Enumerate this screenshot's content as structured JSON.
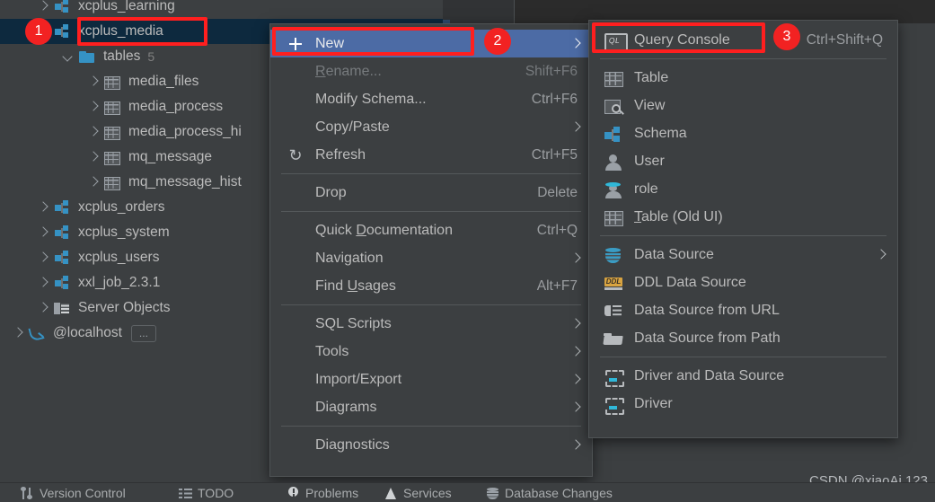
{
  "app": {
    "background": "#3c3f41",
    "accent_blue": "#4c6ba5",
    "annotation_red": "#f22222",
    "icon_blue": "#3592c4"
  },
  "sidebar": {
    "items": [
      {
        "label": "xcplus_learning",
        "icon": "schema-icon",
        "indent": 1,
        "arrow": "right",
        "selected": false
      },
      {
        "label": "xcplus_media",
        "icon": "schema-icon",
        "indent": 1,
        "arrow": "none",
        "selected": true
      },
      {
        "label": "tables",
        "icon": "folder-icon",
        "indent": 2,
        "arrow": "down",
        "selected": false,
        "count": "5"
      },
      {
        "label": "media_files",
        "icon": "table-icon",
        "indent": 3,
        "arrow": "right",
        "selected": false
      },
      {
        "label": "media_process",
        "icon": "table-icon",
        "indent": 3,
        "arrow": "right",
        "selected": false
      },
      {
        "label": "media_process_hi",
        "icon": "table-icon",
        "indent": 3,
        "arrow": "right",
        "selected": false
      },
      {
        "label": "mq_message",
        "icon": "table-icon",
        "indent": 3,
        "arrow": "right",
        "selected": false
      },
      {
        "label": "mq_message_hist",
        "icon": "table-icon",
        "indent": 3,
        "arrow": "right",
        "selected": false
      },
      {
        "label": "xcplus_orders",
        "icon": "schema-icon",
        "indent": 1,
        "arrow": "right",
        "selected": false
      },
      {
        "label": "xcplus_system",
        "icon": "schema-icon",
        "indent": 1,
        "arrow": "right",
        "selected": false
      },
      {
        "label": "xcplus_users",
        "icon": "schema-icon",
        "indent": 1,
        "arrow": "right",
        "selected": false
      },
      {
        "label": "xxl_job_2.3.1",
        "icon": "schema-icon",
        "indent": 1,
        "arrow": "right",
        "selected": false
      },
      {
        "label": "Server Objects",
        "icon": "server-objects-icon",
        "indent": 1,
        "arrow": "right",
        "selected": false
      },
      {
        "label": "@localhost",
        "icon": "mysql-icon",
        "indent": 0,
        "arrow": "right",
        "selected": false,
        "chip": "..."
      }
    ]
  },
  "context_menu": {
    "items": [
      {
        "label": "New",
        "shortcut": "",
        "icon": "plus-icon",
        "submenu": true,
        "highlight": true,
        "disabled": false
      },
      {
        "label": "Rename...",
        "shortcut": "Shift+F6",
        "icon": "",
        "submenu": false,
        "highlight": false,
        "disabled": true,
        "mnemonic": "R"
      },
      {
        "label": "Modify Schema...",
        "shortcut": "Ctrl+F6",
        "icon": "",
        "submenu": false,
        "highlight": false,
        "disabled": false
      },
      {
        "label": "Copy/Paste",
        "shortcut": "",
        "icon": "",
        "submenu": true,
        "highlight": false,
        "disabled": false
      },
      {
        "label": "Refresh",
        "shortcut": "Ctrl+F5",
        "icon": "refresh-icon",
        "submenu": false,
        "highlight": false,
        "disabled": false
      },
      {
        "separator": true
      },
      {
        "label": "Drop",
        "shortcut": "Delete",
        "icon": "",
        "submenu": false,
        "highlight": false,
        "disabled": false
      },
      {
        "separator": true
      },
      {
        "label": "Quick Documentation",
        "shortcut": "Ctrl+Q",
        "icon": "",
        "submenu": false,
        "highlight": false,
        "disabled": false,
        "mnemonic": "D"
      },
      {
        "label": "Navigation",
        "shortcut": "",
        "icon": "",
        "submenu": true,
        "highlight": false,
        "disabled": false
      },
      {
        "label": "Find Usages",
        "shortcut": "Alt+F7",
        "icon": "",
        "submenu": false,
        "highlight": false,
        "disabled": false,
        "mnemonic": "U"
      },
      {
        "separator": true
      },
      {
        "label": "SQL Scripts",
        "shortcut": "",
        "icon": "",
        "submenu": true,
        "highlight": false,
        "disabled": false
      },
      {
        "label": "Tools",
        "shortcut": "",
        "icon": "",
        "submenu": true,
        "highlight": false,
        "disabled": false
      },
      {
        "label": "Import/Export",
        "shortcut": "",
        "icon": "",
        "submenu": true,
        "highlight": false,
        "disabled": false
      },
      {
        "label": "Diagrams",
        "shortcut": "",
        "icon": "",
        "submenu": true,
        "highlight": false,
        "disabled": false
      },
      {
        "separator": true
      },
      {
        "label": "Diagnostics",
        "shortcut": "",
        "icon": "",
        "submenu": true,
        "highlight": false,
        "disabled": false
      }
    ]
  },
  "new_submenu": {
    "items": [
      {
        "label": "Query Console",
        "shortcut": "Ctrl+Shift+Q",
        "icon": "query-console-icon",
        "submenu": false
      },
      {
        "separator": true
      },
      {
        "label": "Table",
        "shortcut": "",
        "icon": "table-grid-icon",
        "submenu": false
      },
      {
        "label": "View",
        "shortcut": "",
        "icon": "view-icon",
        "submenu": false
      },
      {
        "label": "Schema",
        "shortcut": "",
        "icon": "schema-icon",
        "submenu": false
      },
      {
        "label": "User",
        "shortcut": "",
        "icon": "user-icon",
        "submenu": false
      },
      {
        "label": "role",
        "shortcut": "",
        "icon": "role-icon",
        "submenu": false
      },
      {
        "label": "Table (Old UI)",
        "shortcut": "",
        "icon": "table-grid-icon",
        "submenu": false,
        "mnemonic": "T"
      },
      {
        "separator": true
      },
      {
        "label": "Data Source",
        "shortcut": "",
        "icon": "data-source-icon",
        "submenu": true
      },
      {
        "label": "DDL Data Source",
        "shortcut": "",
        "icon": "ddl-icon",
        "submenu": false
      },
      {
        "label": "Data Source from URL",
        "shortcut": "",
        "icon": "url-icon",
        "submenu": false
      },
      {
        "label": "Data Source from Path",
        "shortcut": "",
        "icon": "path-icon",
        "submenu": false
      },
      {
        "separator": true
      },
      {
        "label": "Driver and Data Source",
        "shortcut": "",
        "icon": "driver-icon",
        "submenu": false
      },
      {
        "label": "Driver",
        "shortcut": "",
        "icon": "driver-icon",
        "submenu": false
      }
    ]
  },
  "annotations": {
    "badges": [
      "1",
      "2",
      "3"
    ]
  },
  "status_bar": {
    "items": [
      {
        "label": "Version Control",
        "icon": "version-control-icon"
      },
      {
        "label": "TODO",
        "icon": "todo-icon"
      },
      {
        "label": "Problems",
        "icon": "problems-icon"
      },
      {
        "label": "Services",
        "icon": "services-icon"
      },
      {
        "label": "Database Changes",
        "icon": "database-changes-icon"
      }
    ]
  },
  "watermark": {
    "text": "CSDN @xiaoAi 123"
  },
  "ddl_icon_text": "DDL",
  "ql_icon_text": "QL"
}
